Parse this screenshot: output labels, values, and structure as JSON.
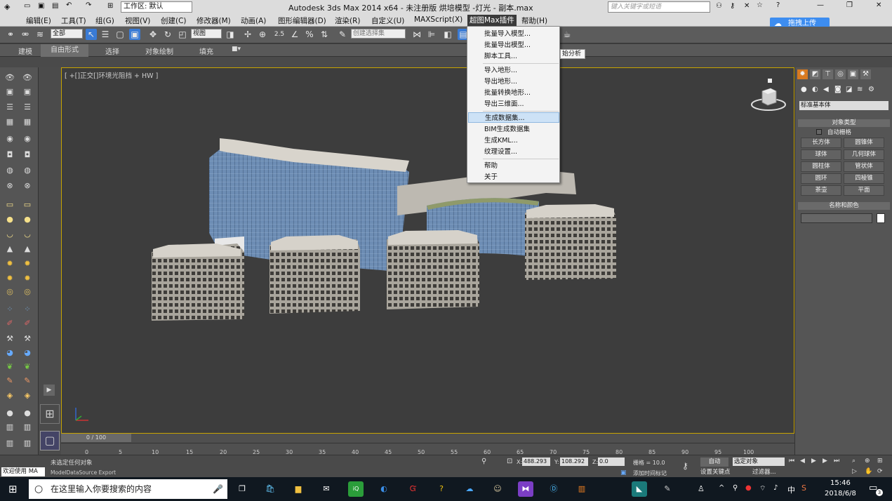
{
  "titlebar": {
    "workspace_label": "工作区: 默认",
    "title": "Autodesk 3ds Max  2014 x64   - 未注册版   烘培模型 -灯光 - 副本.max",
    "search_placeholder": "键入关键字或短语"
  },
  "menubar": {
    "items": [
      "编辑(E)",
      "工具(T)",
      "组(G)",
      "视图(V)",
      "创建(C)",
      "修改器(M)",
      "动画(A)",
      "图形编辑器(D)",
      "渲染(R)",
      "自定义(U)",
      "MAXScript(X)",
      "超图Max插件",
      "帮助(H)"
    ],
    "cloud_upload": "拖拽上传"
  },
  "toolbar": {
    "filter_select": "全部",
    "view_select": "视图",
    "selection_set": "创建选择集"
  },
  "ribbon": {
    "tabs": [
      "建模",
      "自由形式",
      "选择",
      "对象绘制",
      "填充"
    ]
  },
  "dropdown": {
    "items": [
      "批量导入模型...",
      "批量导出模型...",
      "脚本工具...",
      "导入地形...",
      "导出地形...",
      "批量转换地形...",
      "导出三维面...",
      "生成数据集...",
      "BIM生成数据集",
      "生成KML...",
      "纹理设置...",
      "帮助",
      "关于"
    ],
    "highlighted": "生成数据集...",
    "tooltip": "始分析"
  },
  "viewport": {
    "label": "[ +[]正交[]环境光阻挡 + HW ]"
  },
  "rightpanel": {
    "category_select": "标准基本体",
    "object_type_header": "对象类型",
    "autogrid": "自动栅格",
    "buttons": [
      "长方体",
      "圆锥体",
      "球体",
      "几何球体",
      "圆柱体",
      "管状体",
      "圆环",
      "四棱锥",
      "茶壶",
      "平面"
    ],
    "name_color_header": "名称和颜色"
  },
  "timeline": {
    "frame_counter": "0 / 100",
    "ticks": [
      "0",
      "5",
      "10",
      "15",
      "20",
      "25",
      "30",
      "35",
      "40",
      "45",
      "50",
      "55",
      "60",
      "65",
      "70",
      "75",
      "80",
      "85",
      "90",
      "95",
      "100"
    ]
  },
  "status": {
    "welcome": "欢迎使用 MA",
    "maxscript_line": "ModelDataSource Export",
    "selection_msg": "未选定任何对象",
    "x_label": "X:",
    "x_value": "488.293",
    "y_label": "Y:",
    "y_value": "108.292",
    "z_label": "Z:",
    "z_value": "0.0",
    "grid": "栅格 = 10.0",
    "auto_key": "自动",
    "selected_set": "选定对象",
    "set_key": "设置关键点",
    "filters": "过滤器...",
    "add_time_tag": "添加时间标记"
  },
  "taskbar": {
    "search_text": "在这里输入你要搜索的内容",
    "time": "15:46",
    "date": "2018/6/8",
    "ime": "中",
    "notifications": "3"
  },
  "colors": {
    "menu_highlight": "#cde2f6",
    "viewport_border": "#c8a400",
    "cloud_button": "#3d8df0"
  }
}
